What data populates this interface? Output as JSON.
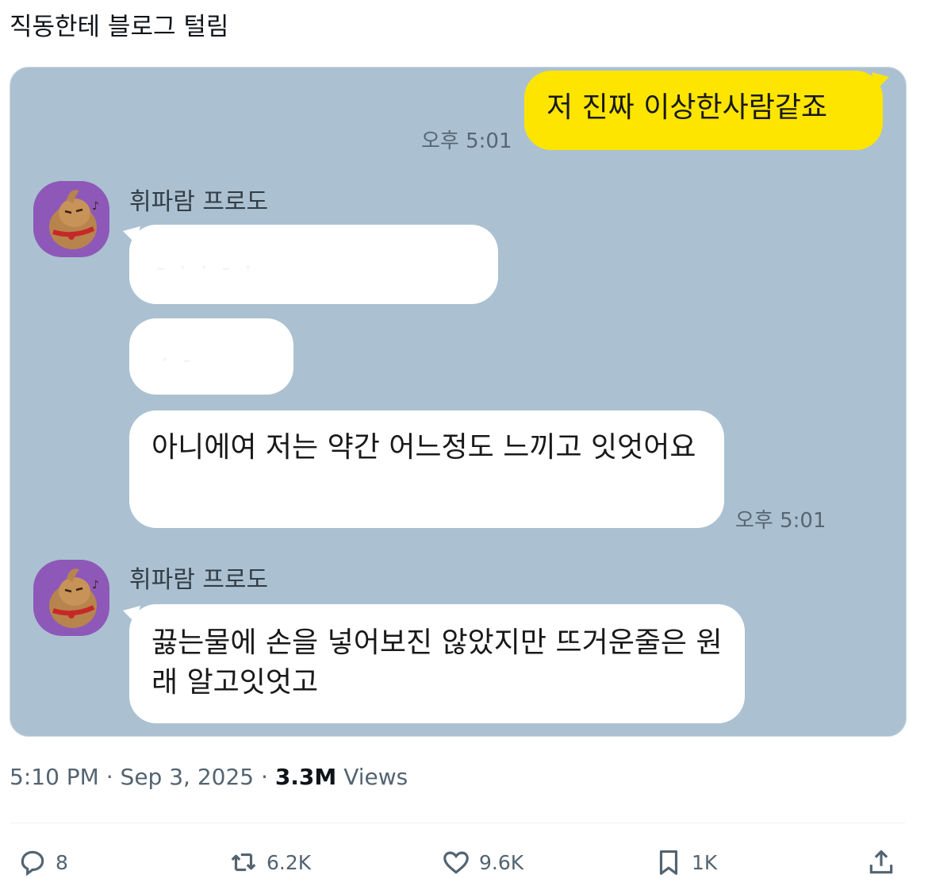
{
  "tweet": {
    "text": "직동한테 블로그 털림",
    "time": "5:10 PM",
    "date": "Sep 3, 2025",
    "views_count": "3.3M",
    "views_label": "Views",
    "separator": "·"
  },
  "chat": {
    "outgoing": {
      "text": "저 진짜 이상한사람같죠",
      "time": "오후 5:01"
    },
    "group1": {
      "sender": "휘파람 프로도",
      "blur1": "- ·   ·   -   ·",
      "blur2": "·  -",
      "message": "아니에여 저는 약간 어느정도 느끼고 잇엇어요",
      "time": "오후 5:01"
    },
    "group2": {
      "sender": "휘파람 프로도",
      "message": "끓는물에 손을 넣어보진 않았지만 뜨거운줄은 원래 알고잇엇고"
    }
  },
  "actions": {
    "replies": "8",
    "reposts": "6.2K",
    "likes": "9.6K",
    "bookmarks": "1K"
  },
  "colors": {
    "chat_bg": "#abc1d1",
    "my_bubble": "#fee500",
    "their_bubble": "#ffffff",
    "avatar_bg": "#8e58b9"
  },
  "icons": [
    "reply-icon",
    "repost-icon",
    "like-icon",
    "bookmark-icon",
    "share-icon"
  ]
}
